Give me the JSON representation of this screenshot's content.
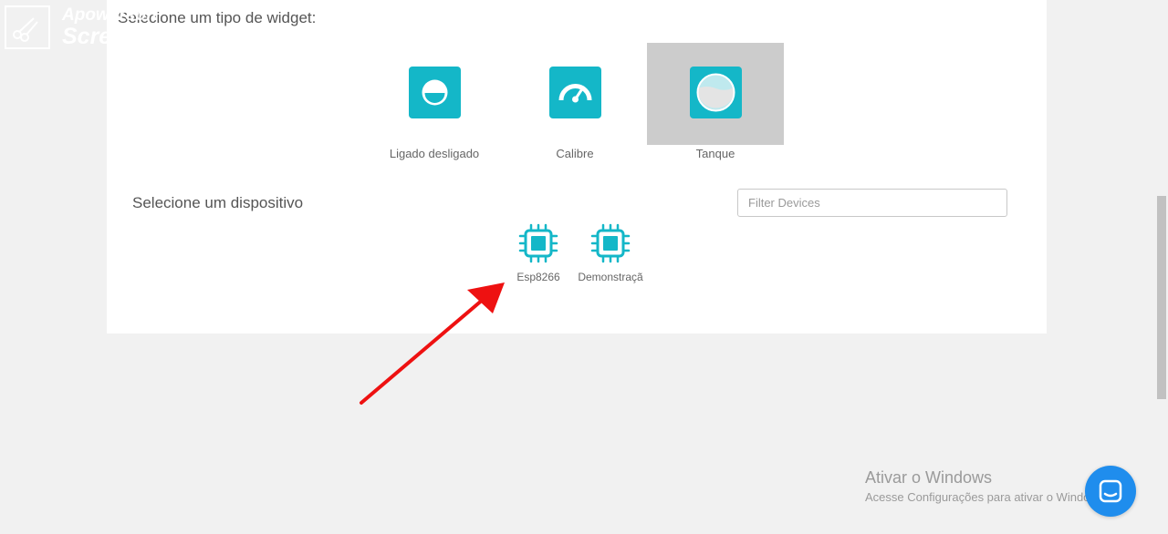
{
  "watermark": {
    "line1": "Apowersoft",
    "line2": "Screen Capture Pro"
  },
  "widget_section": {
    "title": "Selecione um tipo de widget:",
    "widgets": [
      {
        "label": "Ligado desligado",
        "icon": "toggle-icon",
        "selected": false
      },
      {
        "label": "Calibre",
        "icon": "gauge-icon",
        "selected": false
      },
      {
        "label": "Tanque",
        "icon": "tank-icon",
        "selected": true
      }
    ]
  },
  "device_section": {
    "title": "Selecione um dispositivo",
    "filter_placeholder": "Filter Devices",
    "devices": [
      {
        "label": "Esp8266",
        "icon": "chip-icon"
      },
      {
        "label": "Demonstraçã",
        "icon": "chip-icon"
      }
    ]
  },
  "windows_activation": {
    "title": "Ativar o Windows",
    "subtitle": "Acesse Configurações para ativar o Windows."
  },
  "colors": {
    "accent": "#14b7c8",
    "selected_bg": "#cccccc",
    "chat": "#1f8ded",
    "arrow": "#ee1111"
  }
}
